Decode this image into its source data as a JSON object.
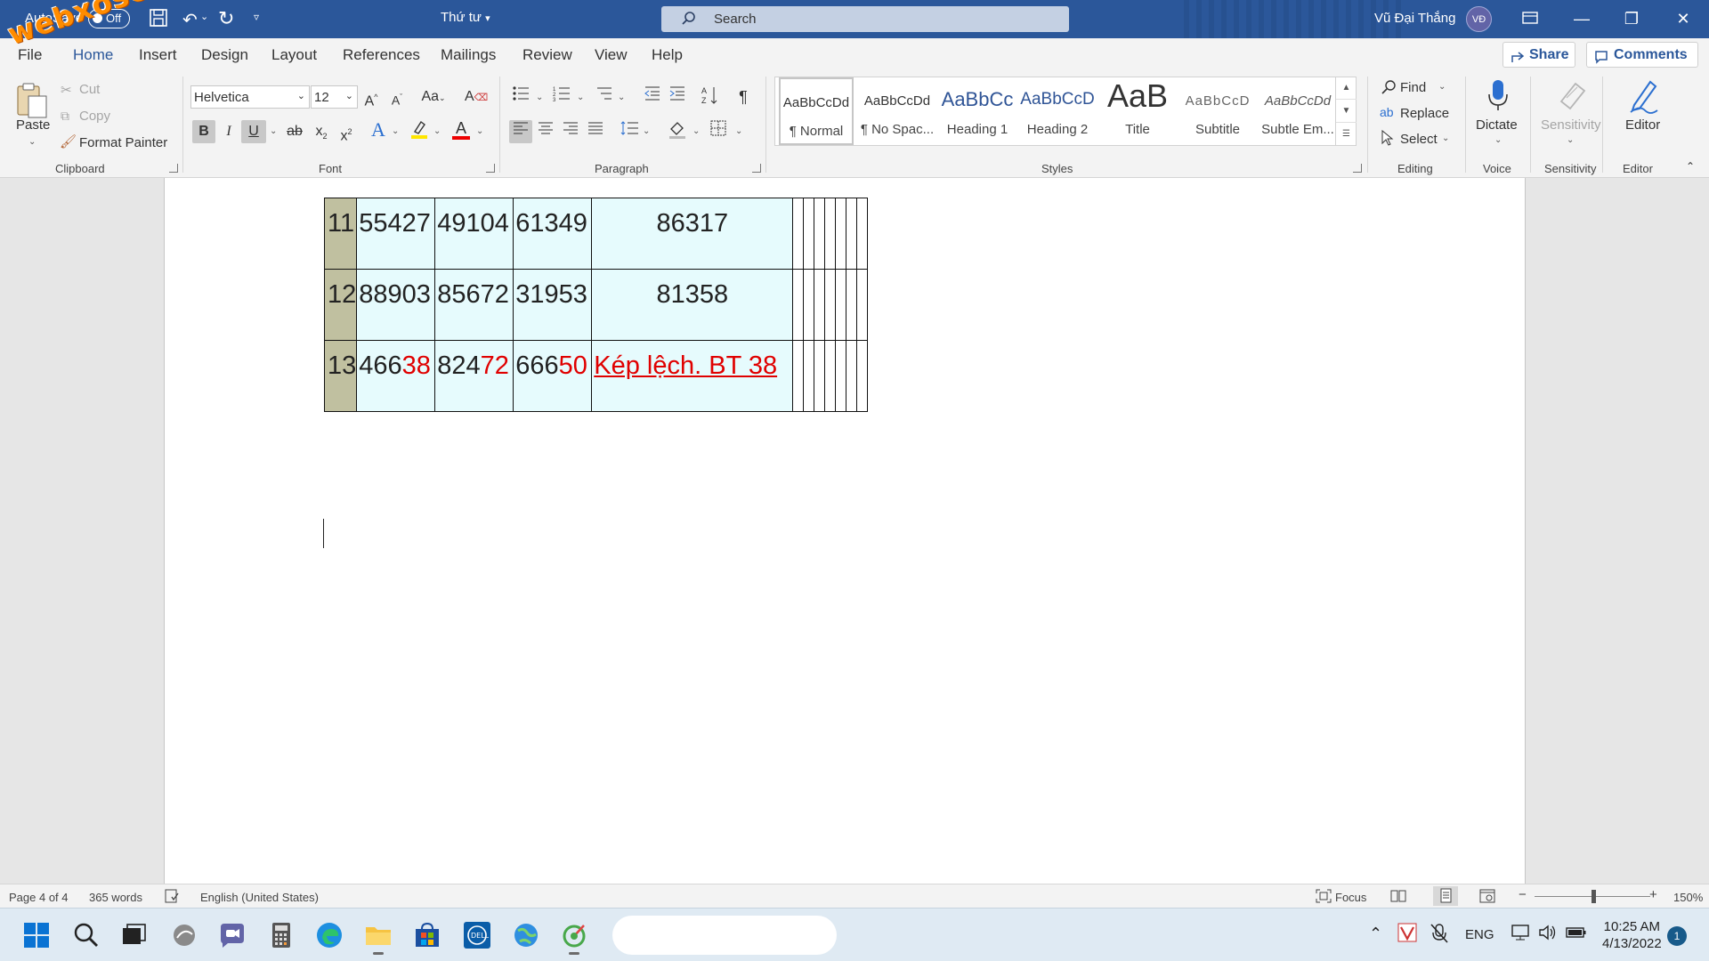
{
  "titlebar": {
    "autosave_label": "AutoSave",
    "autosave_state": "Off",
    "doc_title": "Thứ tư",
    "search_placeholder": "Search",
    "user_name": "Vũ Đại Thắng",
    "user_initials": "VĐ"
  },
  "watermark": "webxoso.net",
  "tabs": [
    "File",
    "Home",
    "Insert",
    "Design",
    "Layout",
    "References",
    "Mailings",
    "Review",
    "View",
    "Help"
  ],
  "share_label": "Share",
  "comments_label": "Comments",
  "clipboard": {
    "paste": "Paste",
    "cut": "Cut",
    "copy": "Copy",
    "format_painter": "Format Painter",
    "group": "Clipboard"
  },
  "font": {
    "family": "Helvetica",
    "size": "12",
    "group": "Font"
  },
  "paragraph": {
    "group": "Paragraph"
  },
  "styles": {
    "group": "Styles",
    "items": [
      {
        "preview": "AaBbCcDd",
        "name": "¶ Normal"
      },
      {
        "preview": "AaBbCcDd",
        "name": "¶ No Spac..."
      },
      {
        "preview": "AaBbCc",
        "name": "Heading 1"
      },
      {
        "preview": "AaBbCcD",
        "name": "Heading 2"
      },
      {
        "preview": "AaB",
        "name": "Title"
      },
      {
        "preview": "AaBbCcD",
        "name": "Subtitle"
      },
      {
        "preview": "AaBbCcDd",
        "name": "Subtle Em..."
      }
    ]
  },
  "editing": {
    "find": "Find",
    "replace": "Replace",
    "select": "Select",
    "group": "Editing"
  },
  "voice": {
    "dictate": "Dictate",
    "group": "Voice"
  },
  "sensitivity": {
    "label": "Sensitivity",
    "group": "Sensitivity"
  },
  "editor": {
    "label": "Editor",
    "group": "Editor"
  },
  "table": {
    "rows": [
      {
        "idx": "11",
        "a": "55427",
        "b": "49104",
        "c": "61349",
        "d": "86317"
      },
      {
        "idx": "12",
        "a": "88903",
        "b": "85672",
        "c": "31953",
        "d": "81358"
      },
      {
        "idx": "13",
        "a_black": "466",
        "a_red": "38",
        "b_black": "824",
        "b_red": "72",
        "c_black": "666",
        "c_red": "50",
        "d": "Kép lệch. BT 38"
      }
    ]
  },
  "status": {
    "page": "Page 4 of 4",
    "words": "365 words",
    "language": "English (United States)",
    "focus": "Focus",
    "zoom": "150%",
    "zoom_minus": "−",
    "zoom_plus": "+"
  },
  "taskbar": {
    "lang": "ENG",
    "time": "10:25 AM",
    "date": "4/13/2022",
    "notifications": "1"
  }
}
